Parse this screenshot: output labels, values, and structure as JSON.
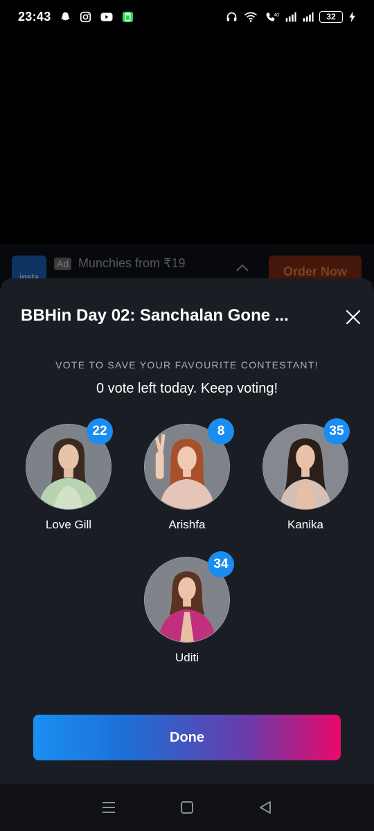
{
  "status_bar": {
    "time": "23:43",
    "battery": "32",
    "left_icons": [
      "snapchat-icon",
      "instagram-icon",
      "youtube-icon",
      "calculator-icon"
    ],
    "right_icons": [
      "headphones-icon",
      "wifi-icon",
      "call-icon",
      "signal-icon",
      "signal-icon",
      "battery-icon",
      "charging-icon"
    ]
  },
  "ad": {
    "tag": "Ad",
    "title": "Munchies from ₹19",
    "brand": "insta",
    "cta": "Order Now"
  },
  "modal": {
    "title": "BBHin Day 02: Sanchalan Gone ...",
    "heading": "VOTE TO SAVE YOUR FAVOURITE CONTESTANT!",
    "subheading": "0 vote left today. Keep voting!",
    "done_label": "Done",
    "accent_color": "#1c8df0",
    "gradient": [
      "#1a8ff2",
      "#e8096a"
    ]
  },
  "contestants": [
    {
      "name": "Love Gill",
      "votes": "22"
    },
    {
      "name": "Arishfa",
      "votes": "8"
    },
    {
      "name": "Kanika",
      "votes": "35"
    },
    {
      "name": "Uditi",
      "votes": "34"
    }
  ],
  "nav": {
    "icons": [
      "menu-icon",
      "home-square-icon",
      "back-triangle-icon"
    ]
  }
}
